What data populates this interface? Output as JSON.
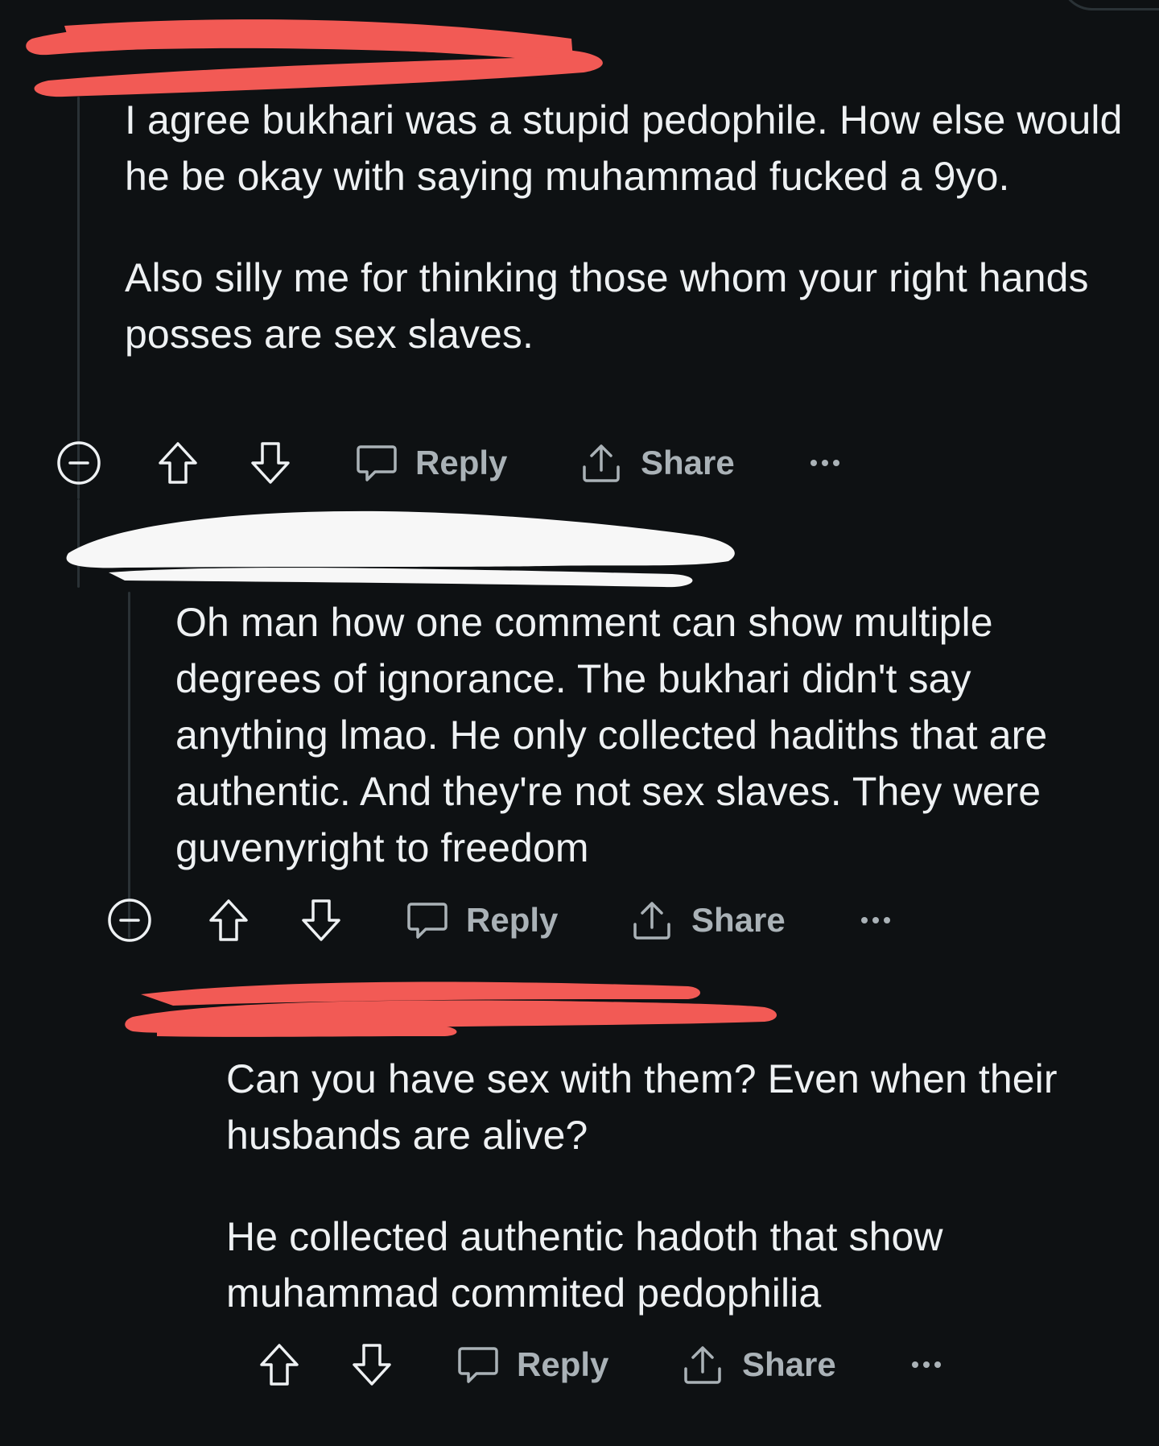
{
  "comments": [
    {
      "paragraphs": [
        "I agree bukhari was a stupid pedophile. How else would he be okay with saying muhammad fucked a 9yo.",
        "Also silly me for thinking those whom your right hands posses are sex slaves."
      ],
      "actions": {
        "reply": "Reply",
        "share": "Share"
      }
    },
    {
      "paragraphs": [
        "Oh man how one comment can show multiple degrees of ignorance. The bukhari didn't say anything lmao. He only collected hadiths that are authentic. And they're not sex slaves. They were guvenyright to freedom"
      ],
      "actions": {
        "reply": "Reply",
        "share": "Share"
      }
    },
    {
      "paragraphs": [
        "Can you have sex with them? Even when their husbands are alive?",
        "He collected authentic hadoth that show muhammad commited pedophilia"
      ],
      "actions": {
        "reply": "Reply",
        "share": "Share"
      }
    }
  ],
  "icons": {
    "collapse": "collapse-icon",
    "upvote": "upvote-arrow-icon",
    "downvote": "downvote-arrow-icon",
    "reply": "speech-bubble-icon",
    "share": "share-upload-icon",
    "more": "more-dots-icon"
  },
  "colors": {
    "background": "#0e1113",
    "text": "#eef1f3",
    "action_text": "#aab2b7",
    "thread_line": "#2a3236",
    "redact_red": "#f25a55",
    "redact_white": "#f7f7f7"
  }
}
